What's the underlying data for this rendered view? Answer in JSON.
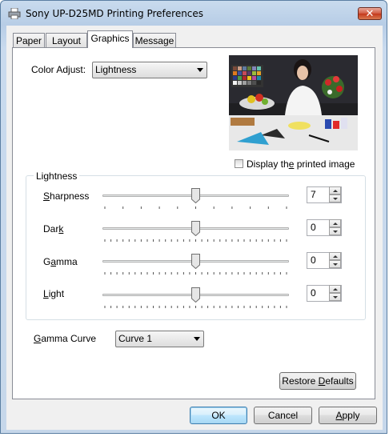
{
  "window": {
    "title": "Sony UP-D25MD Printing Preferences",
    "close_glyph": "✕"
  },
  "tabs": [
    {
      "label": "Paper"
    },
    {
      "label": "Layout"
    },
    {
      "label": "Graphics"
    },
    {
      "label": "Message"
    }
  ],
  "graphics": {
    "color_adjust_label": "Color Adjust:",
    "color_adjust_value": "Lightness",
    "display_printed_image": {
      "pre": "Display th",
      "accel": "e",
      "post": " printed image",
      "checked": false
    },
    "group_title": "Lightness",
    "sliders": [
      {
        "label_accel": "S",
        "label_rest": "harpness",
        "value": "7",
        "position": 0.5,
        "accel_first": true
      },
      {
        "label_pre": "Dar",
        "label_accel": "k",
        "label_rest": "",
        "value": "0",
        "position": 0.5,
        "accel_first": false
      },
      {
        "label_pre": "G",
        "label_accel": "a",
        "label_rest": "mma",
        "value": "0",
        "position": 0.5,
        "accel_first": false
      },
      {
        "label_accel": "L",
        "label_rest": "ight",
        "value": "0",
        "position": 0.5,
        "accel_first": true
      }
    ],
    "gamma_curve": {
      "label_pre": "",
      "label_accel": "G",
      "label_rest": "amma Curve",
      "value": "Curve 1"
    },
    "restore_defaults": {
      "pre": "Restore ",
      "accel": "D",
      "post": "efaults"
    }
  },
  "buttons": {
    "ok": "OK",
    "cancel": "Cancel",
    "apply_accel": "A",
    "apply_rest": "pply"
  },
  "colors": {
    "accent": "#3c7fb1",
    "close": "#c4371c",
    "window_frame": "#b7cde6"
  }
}
